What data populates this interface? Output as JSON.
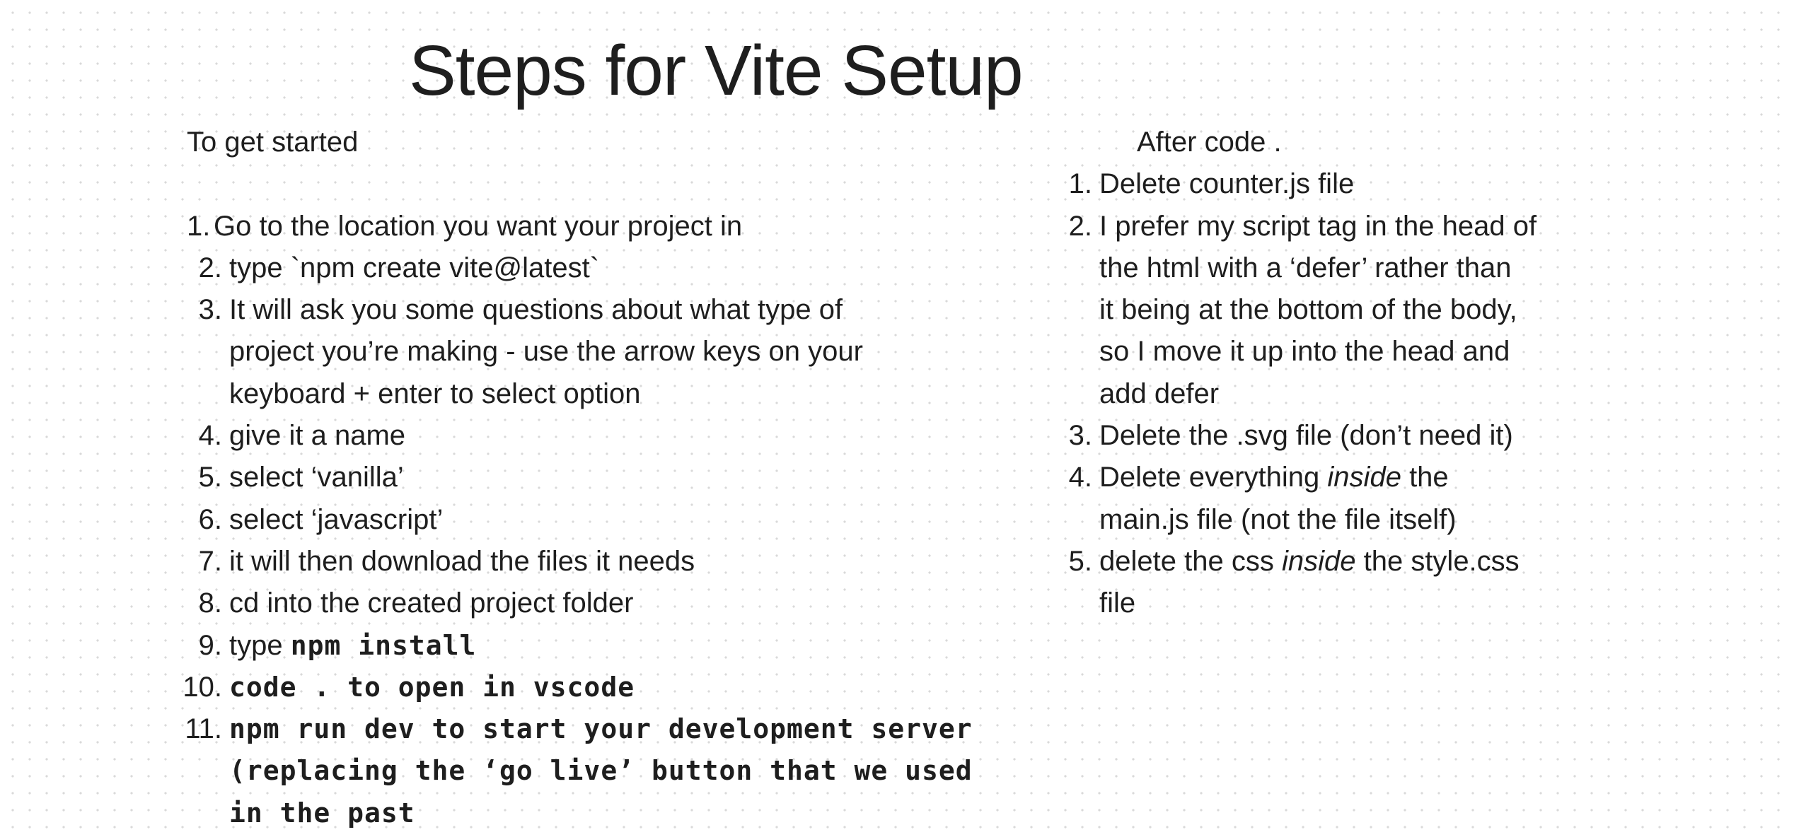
{
  "title": "Steps for Vite Setup",
  "left": {
    "heading": "To get started",
    "items": [
      {
        "num": "1.",
        "lines": [
          "Go to the location you want your project in"
        ]
      },
      {
        "num": "2.",
        "lines": [
          "type `npm create vite@latest`"
        ]
      },
      {
        "num": "3.",
        "lines": [
          "It will ask you some questions about what type of",
          "project you’re making - use the arrow keys on your",
          "keyboard + enter to select option"
        ]
      },
      {
        "num": "4.",
        "lines": [
          "give it a name"
        ]
      },
      {
        "num": "5.",
        "lines": [
          "select ‘vanilla’"
        ]
      },
      {
        "num": "6.",
        "lines": [
          "select ‘javascript’"
        ]
      },
      {
        "num": "7.",
        "lines": [
          "it will then download the files it needs"
        ]
      },
      {
        "num": "8.",
        "lines": [
          "cd into the created project folder"
        ]
      },
      {
        "num": "9.",
        "prefix": "type",
        "code": "npm install"
      },
      {
        "num": "10.",
        "code_lines": [
          "code . to open in vscode"
        ]
      },
      {
        "num": "11.",
        "code_lines": [
          "npm run dev to start your development server",
          "(replacing the ‘go live’ button that we used",
          "in the past"
        ]
      }
    ]
  },
  "right": {
    "heading": "After code .",
    "items": [
      {
        "num": "1.",
        "lines": [
          "Delete counter.js file"
        ]
      },
      {
        "num": "2.",
        "lines": [
          "I prefer my script tag in the head of",
          "the html with a ‘defer’ rather than",
          "it being at the bottom of the body,",
          "so I move it up into the head and",
          "add defer"
        ]
      },
      {
        "num": "3.",
        "lines": [
          "Delete the .svg file (don’t need it)"
        ]
      },
      {
        "num": "4.",
        "before": "Delete everything",
        "em": "inside",
        "after": "the",
        "line2": "main.js file (not the file itself)"
      },
      {
        "num": "5.",
        "before": "delete the css",
        "em": "inside",
        "after": "the style.css",
        "line2": "file"
      }
    ]
  }
}
